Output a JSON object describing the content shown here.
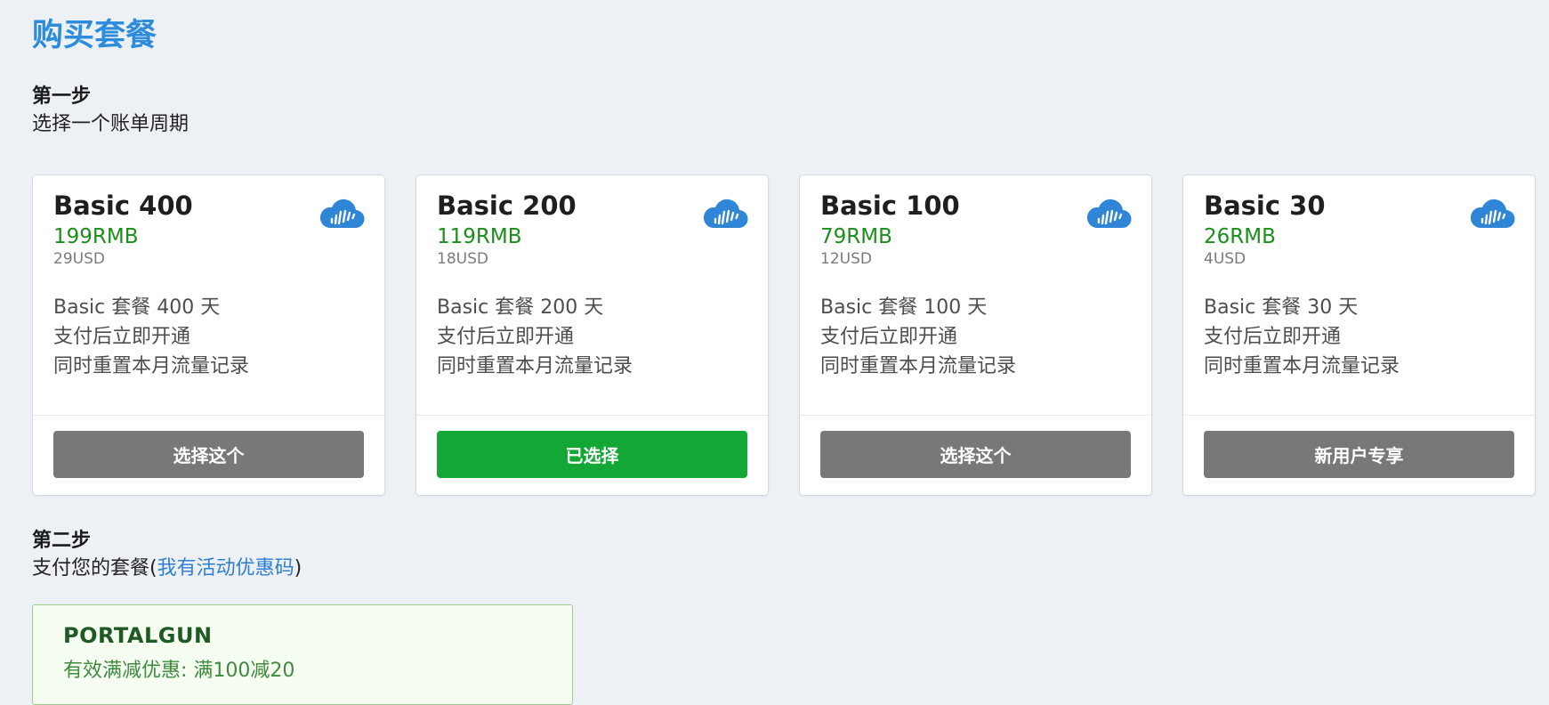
{
  "page": {
    "title": "购买套餐"
  },
  "step1": {
    "heading": "第一步",
    "description": "选择一个账单周期"
  },
  "plans": [
    {
      "name": "Basic 400",
      "price_rmb": "199RMB",
      "price_usd": "29USD",
      "features": [
        "Basic 套餐 400 天",
        "支付后立即开通",
        "同时重置本月流量记录"
      ],
      "button_label": "选择这个",
      "selected": false,
      "icon": "cloud-icon"
    },
    {
      "name": "Basic 200",
      "price_rmb": "119RMB",
      "price_usd": "18USD",
      "features": [
        "Basic 套餐 200 天",
        "支付后立即开通",
        "同时重置本月流量记录"
      ],
      "button_label": "已选择",
      "selected": true,
      "icon": "cloud-icon"
    },
    {
      "name": "Basic 100",
      "price_rmb": "79RMB",
      "price_usd": "12USD",
      "features": [
        "Basic 套餐 100 天",
        "支付后立即开通",
        "同时重置本月流量记录"
      ],
      "button_label": "选择这个",
      "selected": false,
      "icon": "cloud-icon"
    },
    {
      "name": "Basic 30",
      "price_rmb": "26RMB",
      "price_usd": "4USD",
      "features": [
        "Basic 套餐 30 天",
        "支付后立即开通",
        "同时重置本月流量记录"
      ],
      "button_label": "新用户专享",
      "selected": false,
      "icon": "cloud-icon"
    }
  ],
  "step2": {
    "heading": "第二步",
    "description_prefix": "支付您的套餐(",
    "promo_link": "我有活动优惠码",
    "description_suffix": ")"
  },
  "coupon": {
    "code": "PORTALGUN",
    "description": "有效满减优惠: 满100减20"
  },
  "colors": {
    "title_blue": "#2d8cdb",
    "price_green": "#1a8f1a",
    "selected_button_green": "#13a836",
    "default_button_gray": "#787878",
    "link_blue": "#2f7fd0",
    "icon_blue": "#2f86d6",
    "background": "#edf1f5"
  }
}
